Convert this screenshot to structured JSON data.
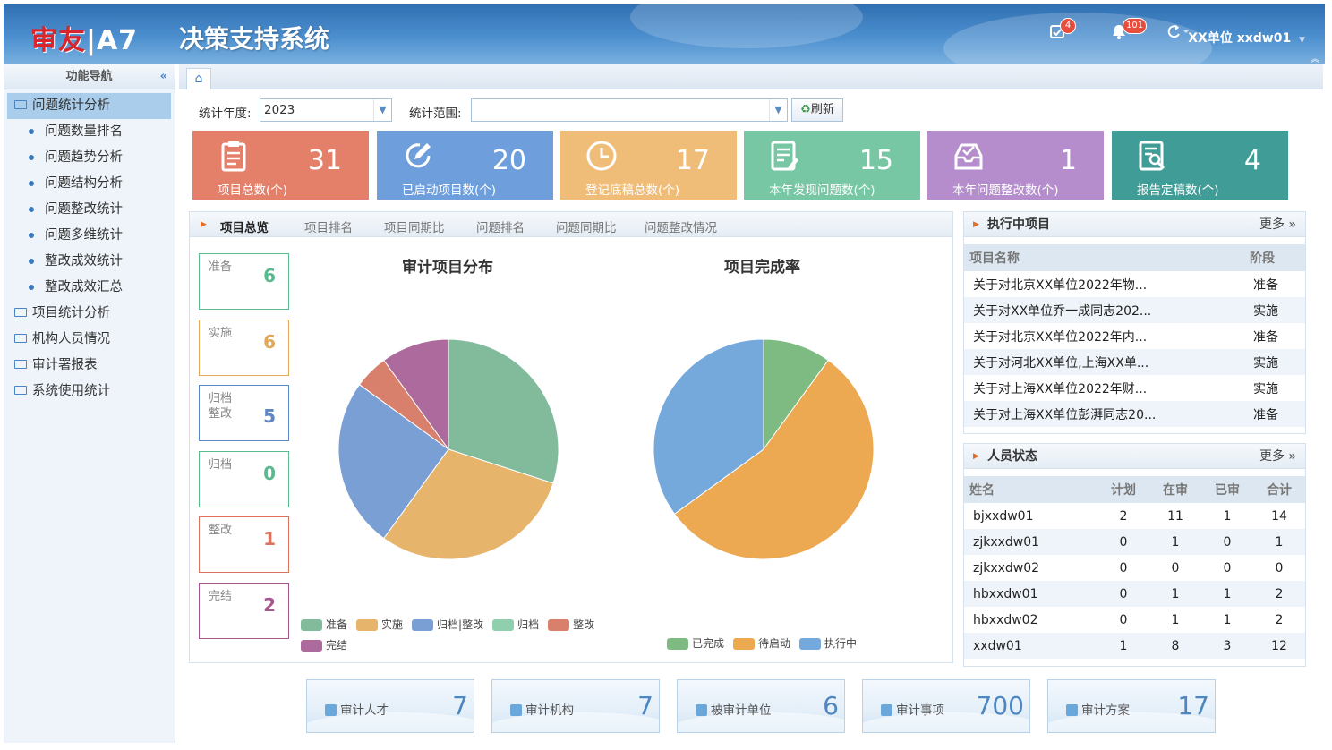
{
  "header": {
    "logo_brand": "审友",
    "logo_product": "A7",
    "system_title": "决策支持系统",
    "task_badge": "4",
    "notice_badge": "101",
    "user_label": "XX单位 xxdw01"
  },
  "sidebar": {
    "title": "功能导航",
    "items": [
      {
        "label": "问题统计分析",
        "type": "group",
        "active": true
      },
      {
        "label": "问题数量排名",
        "type": "sub"
      },
      {
        "label": "问题趋势分析",
        "type": "sub"
      },
      {
        "label": "问题结构分析",
        "type": "sub"
      },
      {
        "label": "问题整改统计",
        "type": "sub"
      },
      {
        "label": "问题多维统计",
        "type": "sub"
      },
      {
        "label": "整改成效统计",
        "type": "sub"
      },
      {
        "label": "整改成效汇总",
        "type": "sub"
      },
      {
        "label": "项目统计分析",
        "type": "group"
      },
      {
        "label": "机构人员情况",
        "type": "group"
      },
      {
        "label": "审计署报表",
        "type": "group"
      },
      {
        "label": "系统使用统计",
        "type": "group"
      }
    ]
  },
  "filters": {
    "year_label": "统计年度:",
    "year_value": "2023",
    "scope_label": "统计范围:",
    "scope_value": "",
    "refresh_label": "刷新"
  },
  "stats": [
    {
      "value": "31",
      "label": "项目总数(个)",
      "color": "#e47f6a",
      "icon": "clipboard-icon"
    },
    {
      "value": "20",
      "label": "已启动项目数(个)",
      "color": "#6e9fdc",
      "icon": "edit-icon"
    },
    {
      "value": "17",
      "label": "登记底稿总数(个)",
      "color": "#efbd78",
      "icon": "clock-icon"
    },
    {
      "value": "15",
      "label": "本年发现问题数(个)",
      "color": "#78c7a4",
      "icon": "report-icon"
    },
    {
      "value": "1",
      "label": "本年问题整改数(个)",
      "color": "#b58dcc",
      "icon": "inbox-check-icon"
    },
    {
      "value": "4",
      "label": "报告定稿数(个)",
      "color": "#3f9c96",
      "icon": "doc-search-icon"
    }
  ],
  "overview": {
    "tabs": [
      "项目总览",
      "项目排名",
      "项目同期比",
      "问题排名",
      "问题同期比",
      "问题整改情况"
    ],
    "status_boxes": [
      {
        "label": "准备",
        "value": "6",
        "color": "#5ab98f"
      },
      {
        "label": "实施",
        "value": "6",
        "color": "#e3a75a"
      },
      {
        "label": "归档\n整改",
        "value": "5",
        "color": "#5c86c4"
      },
      {
        "label": "归档",
        "value": "0",
        "color": "#5ab98f"
      },
      {
        "label": "整改",
        "value": "1",
        "color": "#d9735f"
      },
      {
        "label": "完结",
        "value": "2",
        "color": "#a7578f"
      }
    ]
  },
  "chart_data": [
    {
      "type": "pie",
      "title": "审计项目分布",
      "categories": [
        "准备",
        "实施",
        "归档|整改",
        "归档",
        "整改",
        "完结"
      ],
      "values": [
        6,
        6,
        5,
        0,
        1,
        2
      ],
      "colors": [
        "#82bb9c",
        "#e6b46b",
        "#7a9fd4",
        "#8fcfad",
        "#d9806d",
        "#ac6b9c"
      ],
      "legend": "bottom"
    },
    {
      "type": "pie",
      "title": "项目完成率",
      "categories": [
        "已完成",
        "待启动",
        "执行中"
      ],
      "values": [
        2,
        11,
        7
      ],
      "colors": [
        "#7ebb82",
        "#eca952",
        "#75a9dc"
      ],
      "legend": "bottom"
    }
  ],
  "executing": {
    "title": "执行中项目",
    "more": "更多 »",
    "columns": [
      "项目名称",
      "阶段"
    ],
    "rows": [
      [
        "关于对北京XX单位2022年物...",
        "准备"
      ],
      [
        "关于对XX单位乔一成同志202...",
        "实施"
      ],
      [
        "关于对北京XX单位2022年内...",
        "准备"
      ],
      [
        "关于对河北XX单位,上海XX单...",
        "实施"
      ],
      [
        "关于对上海XX单位2022年财...",
        "实施"
      ],
      [
        "关于对上海XX单位彭湃同志20...",
        "准备"
      ]
    ]
  },
  "personnel": {
    "title": "人员状态",
    "more": "更多 »",
    "columns": [
      "姓名",
      "计划",
      "在审",
      "已审",
      "合计"
    ],
    "rows": [
      [
        "bjxxdw01",
        "2",
        "11",
        "1",
        "14"
      ],
      [
        "zjkxxdw01",
        "0",
        "1",
        "0",
        "1"
      ],
      [
        "zjkxxdw02",
        "0",
        "0",
        "0",
        "0"
      ],
      [
        "hbxxdw01",
        "0",
        "1",
        "1",
        "2"
      ],
      [
        "hbxxdw02",
        "0",
        "1",
        "1",
        "2"
      ],
      [
        "xxdw01",
        "1",
        "8",
        "3",
        "12"
      ]
    ]
  },
  "bottom_cards": [
    {
      "label": "审计人才",
      "value": "7"
    },
    {
      "label": "审计机构",
      "value": "7"
    },
    {
      "label": "被审计单位",
      "value": "6"
    },
    {
      "label": "审计事项",
      "value": "700"
    },
    {
      "label": "审计方案",
      "value": "17"
    }
  ]
}
